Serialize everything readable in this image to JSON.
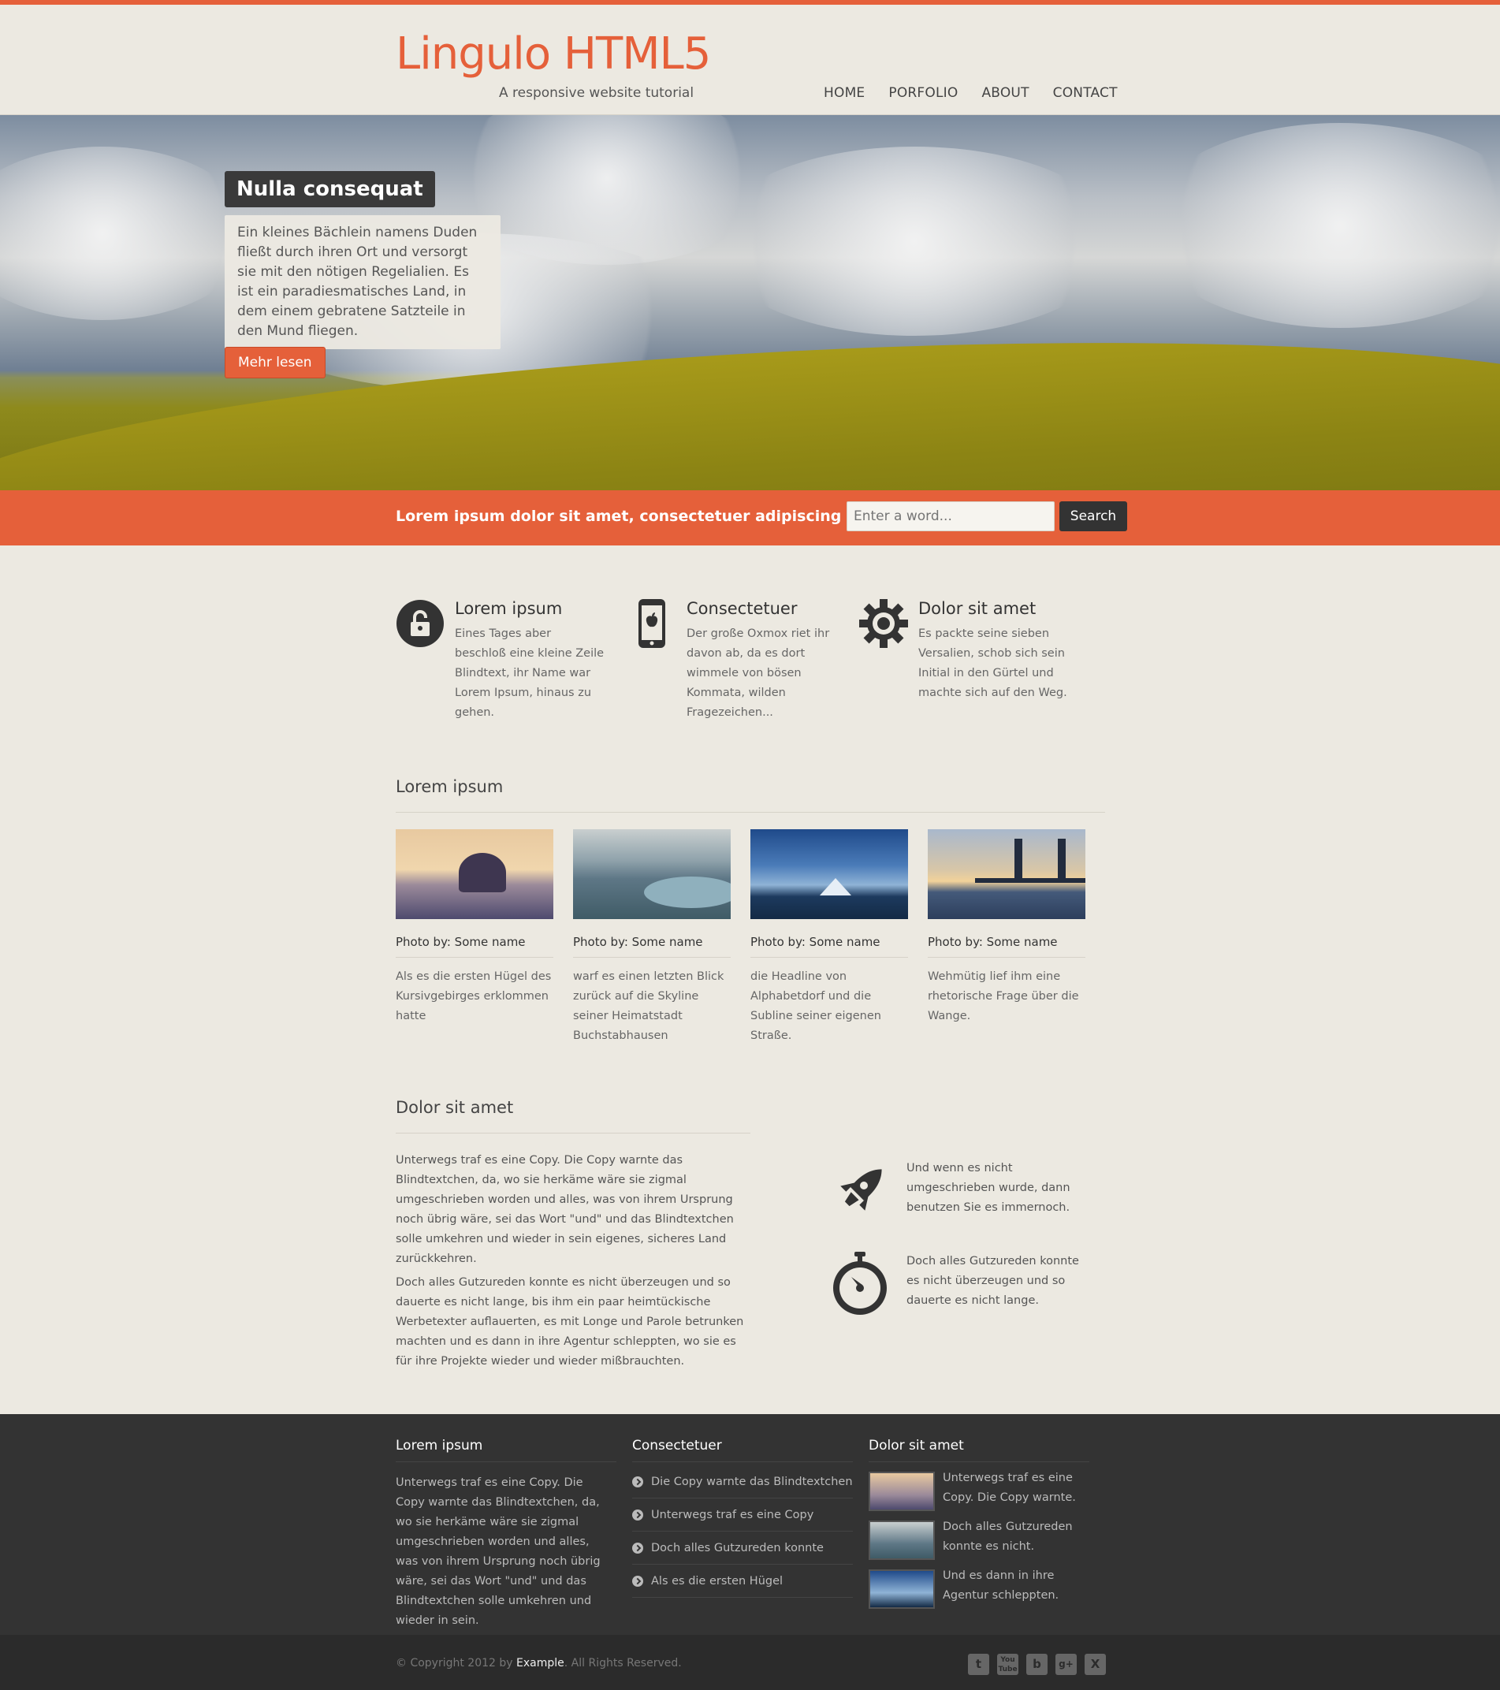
{
  "header": {
    "logo": "Lingulo HTML5",
    "tagline": "A responsive website tutorial",
    "nav": [
      "HOME",
      "PORFOLIO",
      "ABOUT",
      "CONTACT"
    ]
  },
  "hero": {
    "title": "Nulla consequat",
    "text": "Ein kleines Bächlein namens Duden fließt durch ihren Ort und versorgt sie mit den nötigen Regelialien. Es ist ein paradiesmatisches Land, in dem einem gebratene Satzteile in den Mund fliegen.",
    "button": "Mehr lesen"
  },
  "search": {
    "text": "Lorem ipsum dolor sit amet, consectetuer adipiscing elit?",
    "placeholder": "Enter a word...",
    "button": "Search"
  },
  "features": [
    {
      "icon": "lock-icon",
      "title": "Lorem ipsum",
      "text": "Eines Tages aber beschloß eine kleine Zeile Blindtext, ihr Name war Lorem Ipsum, hinaus zu gehen."
    },
    {
      "icon": "phone-icon",
      "title": "Consectetuer",
      "text": "Der große Oxmox riet ihr davon ab, da es dort wimmele von bösen Kommata, wilden Fragezeichen..."
    },
    {
      "icon": "gear-icon",
      "title": "Dolor sit amet",
      "text": "Es packte seine sieben Versalien, schob sich sein Initial in den Gürtel und machte sich auf den Weg."
    }
  ],
  "gallery": {
    "title": "Lorem ipsum",
    "items": [
      {
        "caption": "Photo by: Some name",
        "text": "Als es die ersten Hügel des Kursivgebirges erklommen hatte"
      },
      {
        "caption": "Photo by: Some name",
        "text": "warf es einen letzten Blick zurück auf die Skyline seiner Heimatstadt Buchstabhausen"
      },
      {
        "caption": "Photo by: Some name",
        "text": "die Headline von Alphabetdorf und die Subline seiner eigenen Straße."
      },
      {
        "caption": "Photo by: Some name",
        "text": "Wehmütig lief ihm eine rhetorische Frage über die Wange."
      }
    ]
  },
  "dolor": {
    "title": "Dolor sit amet",
    "p1": "Unterwegs traf es eine Copy. Die Copy warnte das Blindtextchen, da, wo sie herkäme wäre sie zigmal umgeschrieben worden und alles, was von ihrem Ursprung noch übrig wäre, sei das Wort \"und\" und das Blindtextchen solle umkehren und wieder in sein eigenes, sicheres Land zurückkehren.",
    "p2": "Doch alles Gutzureden konnte es nicht überzeugen und so dauerte es nicht lange, bis ihm ein paar heimtückische Werbetexter auflauerten, es mit Longe und Parole betrunken machten und es dann in ihre Agentur schleppten, wo sie es für ihre Projekte wieder und wieder mißbrauchten.",
    "aside": [
      {
        "icon": "rocket-icon",
        "text": "Und wenn es nicht umgeschrieben wurde, dann benutzen Sie es immernoch."
      },
      {
        "icon": "stopwatch-icon",
        "text": "Doch alles Gutzureden konnte es nicht überzeugen und so dauerte es nicht lange."
      }
    ]
  },
  "footer": {
    "col1": {
      "title": "Lorem ipsum",
      "text": "Unterwegs traf es eine Copy. Die Copy warnte das Blindtextchen, da, wo sie herkäme wäre sie zigmal umgeschrieben worden und alles, was von ihrem Ursprung noch übrig wäre, sei das Wort \"und\" und das Blindtextchen solle umkehren und wieder in sein."
    },
    "col2": {
      "title": "Consectetuer",
      "links": [
        "Die Copy warnte das Blindtextchen",
        "Unterwegs traf es eine Copy",
        "Doch alles Gutzureden konnte",
        "Als es die ersten Hügel"
      ]
    },
    "col3": {
      "title": "Dolor sit amet",
      "items": [
        "Unterwegs traf es eine Copy. Die Copy warnte.",
        "Doch alles Gutzureden konnte es nicht.",
        "Und es dann in ihre Agentur schleppten."
      ]
    }
  },
  "bottom": {
    "copy_pre": "© Copyright 2012 by ",
    "copy_brand": "Example",
    "copy_post": ". All Rights Reserved.",
    "social": [
      "tumblr-icon",
      "youtube-icon",
      "blogger-icon",
      "google-plus-icon",
      "xing-icon"
    ]
  },
  "colors": {
    "accent": "#e5603a",
    "dark": "#333333",
    "background": "#ece9e1"
  }
}
